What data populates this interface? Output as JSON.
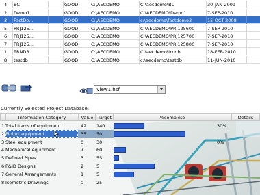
{
  "projects": [
    {
      "num": "4",
      "name": "BC",
      "db": "",
      "status": "GOOD",
      "path1": "C:\\AECDEMO",
      "path2": "C:\\aecdemo\\BC",
      "date": "30-JAN-2009",
      "selected": false
    },
    {
      "num": "2",
      "name": "Demo1",
      "db": "",
      "status": "GOOD",
      "path1": "C:\\AECDEMO",
      "path2": "C:\\AECDEMO\\Demo1",
      "date": "7-SEP-2010",
      "selected": false
    },
    {
      "num": "3",
      "name": "FactDe...",
      "db": "",
      "status": "GOOD",
      "path1": "C:\\AECDEMO",
      "path2": "c:\\aecdemo\\factdemo3",
      "date": "15-OCT-2008",
      "selected": true
    },
    {
      "num": "5",
      "name": "PRJ125...",
      "db": "",
      "status": "GOOD",
      "path1": "C:\\AECDEMO",
      "path2": "C:\\AECDEMO\\PRJ125600",
      "date": "7-SEP-2010",
      "selected": false
    },
    {
      "num": "6",
      "name": "PRJ125...",
      "db": "",
      "status": "GOOD",
      "path1": "C:\\AECDEMO",
      "path2": "C:\\AECDEMO\\PRJ125700",
      "date": "7-SEP-2010",
      "selected": false
    },
    {
      "num": "7",
      "name": "PRJ125...",
      "db": "",
      "status": "GOOD",
      "path1": "C:\\AECDEMO",
      "path2": "C:\\AECDEMO\\PRJ125800",
      "date": "7-SEP-2010",
      "selected": false
    },
    {
      "num": "1",
      "name": "TRNDB",
      "db": "",
      "status": "GOOD",
      "path1": "C:\\AECDEMO",
      "path2": "C:\\aecdemo\\trndb",
      "date": "18-FEB-2010",
      "selected": false
    },
    {
      "num": "8",
      "name": "testdb",
      "db": "",
      "status": "GOOD",
      "path1": "C:\\AECDEMO",
      "path2": "c:\\aecdemo\\testdb",
      "date": "11-JUN-2010",
      "selected": false
    }
  ],
  "view_select": {
    "value": "View1.hsf"
  },
  "db_label": "Currently Selected Project Database:",
  "grid": {
    "headers": {
      "category": "Information Category",
      "value": "Value",
      "target": "Target",
      "complete": "%complete",
      "details": "Details"
    },
    "rows": [
      {
        "num": "1",
        "category": "Total Items of equipment",
        "value": "42",
        "target": "140",
        "pct": 0.3,
        "pct_label": "30%",
        "selected": false
      },
      {
        "num": "2",
        "category": "Piping equipment",
        "value": "35",
        "target": "50",
        "pct": 0.7,
        "pct_label": "",
        "selected": true
      },
      {
        "num": "3",
        "category": "Steel equipment",
        "value": "0",
        "target": "30",
        "pct": 0.0,
        "pct_label": "0%",
        "selected": false
      },
      {
        "num": "4",
        "category": "Mechanical equipment",
        "value": "7",
        "target": "60",
        "pct": 0.12,
        "pct_label": "",
        "selected": false
      },
      {
        "num": "5",
        "category": "Defined Pipes",
        "value": "3",
        "target": "55",
        "pct": 0.05,
        "pct_label": "",
        "selected": false
      },
      {
        "num": "6",
        "category": "P&ID Designs",
        "value": "2",
        "target": "5",
        "pct": 0.4,
        "pct_label": "",
        "selected": false
      },
      {
        "num": "7",
        "category": "General Arrangements",
        "value": "1",
        "target": "5",
        "pct": 0.2,
        "pct_label": "",
        "selected": false
      },
      {
        "num": "8",
        "category": "Isometric Drawings",
        "value": "0",
        "target": "25",
        "pct": 0.0,
        "pct_label": "",
        "selected": false
      }
    ]
  },
  "colors": {
    "selection": "#3470c8",
    "bar": "#2d5fd0"
  },
  "icons": {
    "tool_1": "link-back-icon",
    "tool_2": "folder-arrow-icon",
    "view": "eye-view-icon"
  }
}
